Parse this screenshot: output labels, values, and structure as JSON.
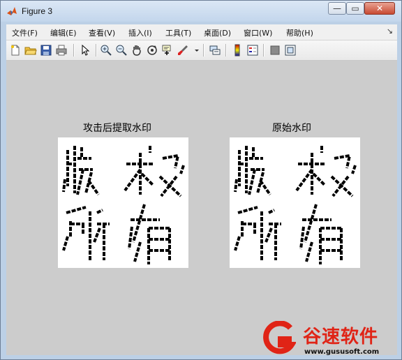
{
  "window": {
    "title": "Figure 3",
    "controls": {
      "minimize": "—",
      "maximize": "▭",
      "close": "✕"
    }
  },
  "menu": {
    "items": [
      "文件(F)",
      "编辑(E)",
      "查看(V)",
      "插入(I)",
      "工具(T)",
      "桌面(D)",
      "窗口(W)",
      "帮助(H)"
    ],
    "overflow_arrow": "↘"
  },
  "toolbar": {
    "icons": [
      "new-figure-icon",
      "open-folder-icon",
      "save-icon",
      "print-icon",
      "pointer-icon",
      "zoom-in-icon",
      "zoom-out-icon",
      "pan-hand-icon",
      "rotate-3d-icon",
      "data-cursor-icon",
      "brush-icon",
      "link-plot-icon",
      "colorbar-icon",
      "legend-icon",
      "hide-plot-tools-icon",
      "show-plot-tools-icon"
    ]
  },
  "figure": {
    "background": "#cccccc",
    "axes": [
      {
        "title": "攻击后提取水印",
        "image": "watermark-binary-image"
      },
      {
        "title": "原始水印",
        "image": "watermark-binary-image"
      }
    ]
  },
  "watermark_logo": {
    "name": "谷速软件",
    "url": "www.gususoft.com",
    "accent": "#e02416"
  }
}
